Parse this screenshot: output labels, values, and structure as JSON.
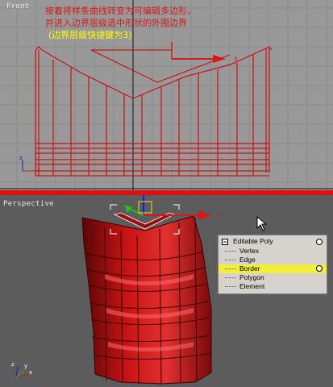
{
  "viewport_front": {
    "label": "Front"
  },
  "viewport_perspective": {
    "label": "Perspective"
  },
  "annotation": {
    "line1": "接着将样条曲线转变为可编辑多边形，",
    "line2": "并进入边界层级选中形状的外围边界",
    "line3": "(边界层级快捷键为3)"
  },
  "gizmo": {
    "x_axis": "x",
    "y_axis": "y",
    "z_axis": "z"
  },
  "modifier_stack": {
    "root": "Editable Poly",
    "items": [
      {
        "label": "Vertex",
        "selected": false
      },
      {
        "label": "Edge",
        "selected": false
      },
      {
        "label": "Border",
        "selected": true
      },
      {
        "label": "Polygon",
        "selected": false
      },
      {
        "label": "Element",
        "selected": false
      }
    ]
  },
  "colors": {
    "front_bg": "#999999",
    "perspective_bg": "#5c5c5c",
    "grid": "#8a8a8a",
    "wire": "#cc1111",
    "separator": "#e01010",
    "annotation_red": "#d81818",
    "annotation_yellow": "#ffff00",
    "selection_highlight": "#f2ee3a"
  }
}
